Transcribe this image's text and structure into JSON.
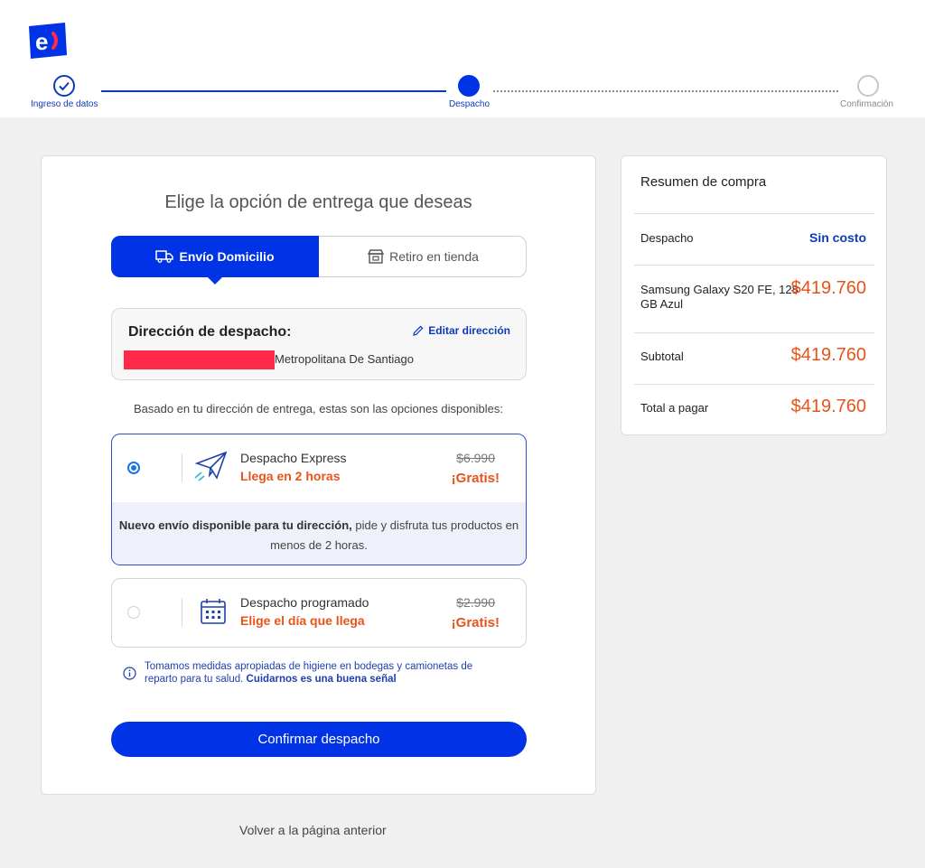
{
  "colors": {
    "brand_blue": "#0032e6",
    "accent_orange": "#e8531a",
    "link_blue": "#0d3bb8"
  },
  "stepper": {
    "steps": [
      {
        "label": "Ingreso de datos",
        "state": "done"
      },
      {
        "label": "Despacho",
        "state": "current"
      },
      {
        "label": "Confirmación",
        "state": "pending"
      }
    ]
  },
  "main": {
    "title": "Elige la opción de entrega que deseas",
    "tabs": [
      {
        "label": "Envío Domicilio",
        "icon": "truck-icon",
        "active": true
      },
      {
        "label": "Retiro en tienda",
        "icon": "store-icon",
        "active": false
      }
    ],
    "address": {
      "title": "Dirección de despacho:",
      "edit_label": "Editar dirección",
      "text": "Metropolitana De Santiago"
    },
    "options_intro": "Basado en tu dirección de entrega, estas son las opciones disponibles:",
    "options": [
      {
        "name": "Despacho Express",
        "subtitle": "Llega en 2 horas",
        "old_price": "$6.990",
        "price": "¡Gratis!",
        "selected": true,
        "icon": "paper-plane-icon",
        "note_bold": "Nuevo envío disponible para tu dirección,",
        "note_rest": " pide y disfruta tus productos en menos de 2 horas."
      },
      {
        "name": "Despacho programado",
        "subtitle": "Elige el día que llega",
        "old_price": "$2.990",
        "price": "¡Gratis!",
        "selected": false,
        "icon": "calendar-icon"
      }
    ],
    "hygiene": {
      "text": "Tomamos medidas apropiadas de higiene en bodegas y camionetas de reparto para tu salud.",
      "bold": "Cuidarnos es una buena señal"
    },
    "confirm_label": "Confirmar despacho"
  },
  "back_label": "Volver a la página anterior",
  "summary": {
    "title": "Resumen de compra",
    "shipping_label": "Despacho",
    "shipping_value": "Sin costo",
    "product_name": "Samsung Galaxy S20 FE, 128 GB Azul",
    "product_price": "$419.760",
    "subtotal_label": "Subtotal",
    "subtotal_value": "$419.760",
    "total_label": "Total a pagar",
    "total_value": "$419.760"
  }
}
